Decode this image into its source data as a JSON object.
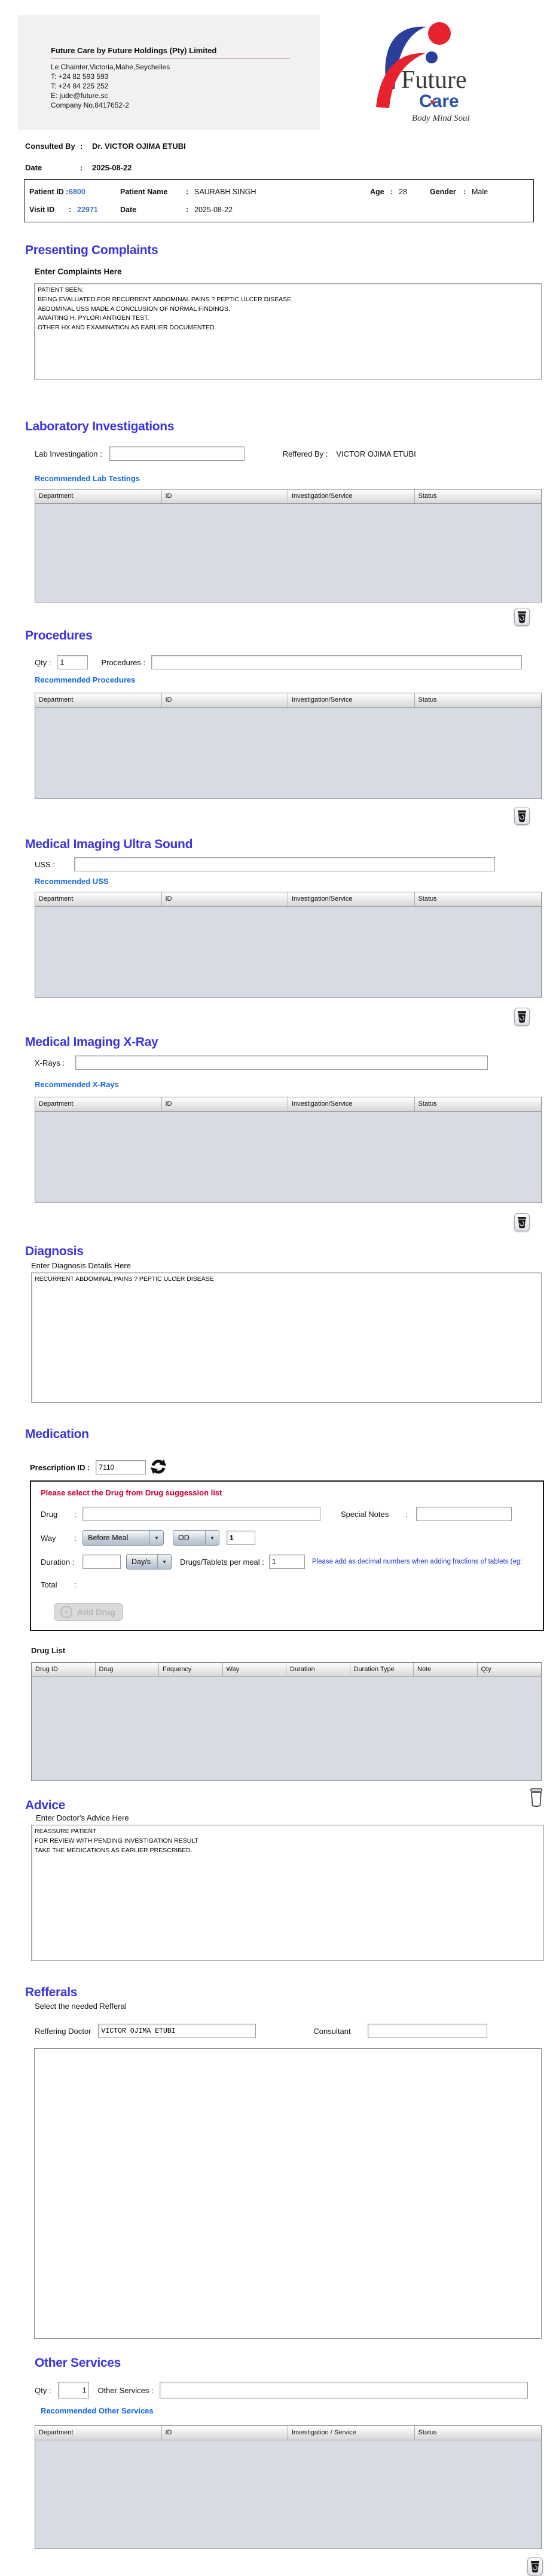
{
  "colors": {
    "heading_blue": "#3a35e0",
    "link_blue": "#1569e0",
    "id_blue": "#4472c4",
    "alert_red": "#cc0033",
    "note_blue": "#2338cc",
    "table_body_gray": "#d7dbe3",
    "logo_blue": "#2a3f9b",
    "logo_red": "#e8212e"
  },
  "glyphs": {
    "dropdown_arrow": "▼",
    "plus": "+",
    "heart": "♥"
  },
  "punct": {
    "colon": ":"
  },
  "letterhead": {
    "company_name": "Future Care by Future Holdings (Pty) Limited",
    "address": "Le Chainter,Victoria,Mahe,Seychelles",
    "phone1": "T: +24  82 593 593",
    "phone2": "T: +24  84 225 252",
    "email": "E: jude@future.sc",
    "company_no": "Company No.8417652-2",
    "logo": {
      "line1": "Future",
      "line2": "Care",
      "tagline": "Body Mind Soul"
    }
  },
  "consultation": {
    "consulted_by_label": "Consulted By",
    "consulted_by": "Dr.  VICTOR OJIMA ETUBI",
    "date_label": "Date",
    "date": "2025-08-22"
  },
  "patient": {
    "patient_id_label": "Patient ID :",
    "patient_id": "6800",
    "patient_name_label": "Patient Name",
    "patient_name": "SAURABH SINGH",
    "age_label": "Age",
    "age": "28",
    "gender_label": "Gender",
    "gender": "Male",
    "visit_id_label": "Visit ID",
    "visit_id": "22971",
    "date_label": "Date",
    "date": "2025-08-22"
  },
  "complaints": {
    "title": "Presenting Complaints",
    "label": "Enter Complaints Here",
    "text": "PATIENT SEEN.\nBEING EVALUATED FOR RECURRENT ABDOMINAL PAINS ? PEPTIC ULCER DISEASE.\nABDOMINAL USS MADE A CONCLUSION OF NORMAL FINDINGS.\nAWAITING H. PYLORI ANTIGEN TEST.\nOTHER HX AND EXAMINATION AS EARLIER DOCUMENTED."
  },
  "standard_columns": [
    "Department",
    "ID",
    "Investigation/Service",
    "Status"
  ],
  "lab": {
    "title": "Laboratory  Investigations",
    "input_label": "Lab Investingation :",
    "input_value": "",
    "referred_label": "Reffered By :",
    "referred_by": "VICTOR OJIMA ETUBI",
    "link": "Recommended Lab Testings"
  },
  "procedures": {
    "title": "Procedures",
    "qty_label": "Qty :",
    "qty": "1",
    "input_label": "Procedures :",
    "input_value": "",
    "link": "Recommended Procedures"
  },
  "uss": {
    "title": "Medical Imaging Ultra Sound",
    "input_label": "USS :",
    "input_value": "",
    "link": "Recommended USS"
  },
  "xray": {
    "title": "Medical Imaging X-Ray",
    "input_label": "X-Rays :",
    "input_value": "",
    "link": "Recommended X-Rays"
  },
  "diagnosis": {
    "title": "Diagnosis",
    "label": "Enter Diagnosis Details Here",
    "text": "RECURRENT ABDOMINAL PAINS ? PEPTIC ULCER DISEASE"
  },
  "medication": {
    "title": "Medication",
    "prescription_label": "Prescription ID :",
    "prescription_id": "7110",
    "drug_note": "Please select the Drug from Drug suggession list",
    "drug_label": "Drug",
    "drug_value": "",
    "special_notes_label": "Special Notes",
    "special_notes_value": "",
    "way_label": "Way",
    "way_value": "Before Meal",
    "frequency_value": "OD",
    "frequency_qty": "1",
    "duration_label": "Duration :",
    "duration_value": "",
    "duration_unit": "Day/s",
    "per_meal_label": "Drugs/Tablets per meal :",
    "per_meal_value": "1",
    "fraction_note": "Please add as decimal numbers when adding fractions of tablets (eg:",
    "total_label": "Total",
    "add_drug_label": "Add Drug",
    "drug_list_label": "Drug List",
    "drug_columns": [
      "Drug ID",
      "Drug",
      "Fequency",
      "Way",
      "Duration",
      "Duration Type",
      "Note",
      "Qty"
    ]
  },
  "advice": {
    "title": "Advice",
    "label": "Enter Doctor's Advice Here",
    "text": "REASSURE PATIENT\nFOR REVIEW WITH PENDING INVESTIGATION RESULT\nTAKE THE MEDICATIONS AS EARLIER PRESCRIBED."
  },
  "referrals": {
    "title": "Refferals",
    "label": "Select the needed Refferal",
    "doctor_label": "Reffering Doctor",
    "doctor_value": "VICTOR OJIMA ETUBI",
    "consultant_label": "Consultant",
    "consultant_value": ""
  },
  "other_services": {
    "title": "Other Services",
    "qty_label": "Qty :",
    "qty": "1",
    "input_label": "Other Services :",
    "input_value": "",
    "link": "Recommended Other Services",
    "columns": [
      "Department",
      "ID",
      "Investigation / Service",
      "Status"
    ]
  }
}
